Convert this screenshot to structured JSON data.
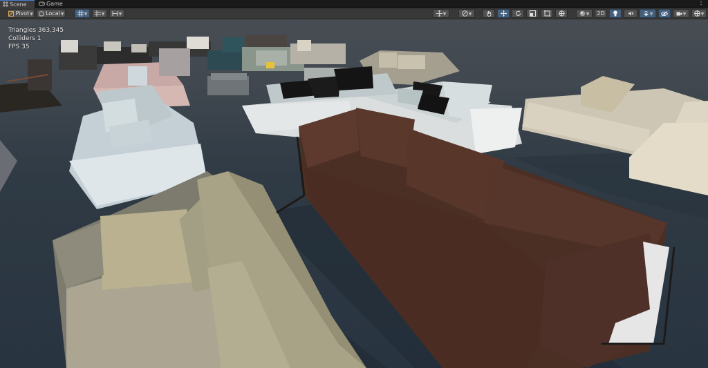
{
  "tabs": [
    {
      "label": "Scene",
      "icon": "hash-grid-icon",
      "active": true
    },
    {
      "label": "Game",
      "icon": "gamepad-icon",
      "active": false
    }
  ],
  "toolbar": {
    "pivot_label": "Pivot",
    "local_label": "Local",
    "mode_2d_label": "2D",
    "accent_color": "#46607c"
  },
  "stats": {
    "triangles": "Triangles 363,345",
    "colliders": "Colliders 1",
    "fps": "FPS 35"
  }
}
